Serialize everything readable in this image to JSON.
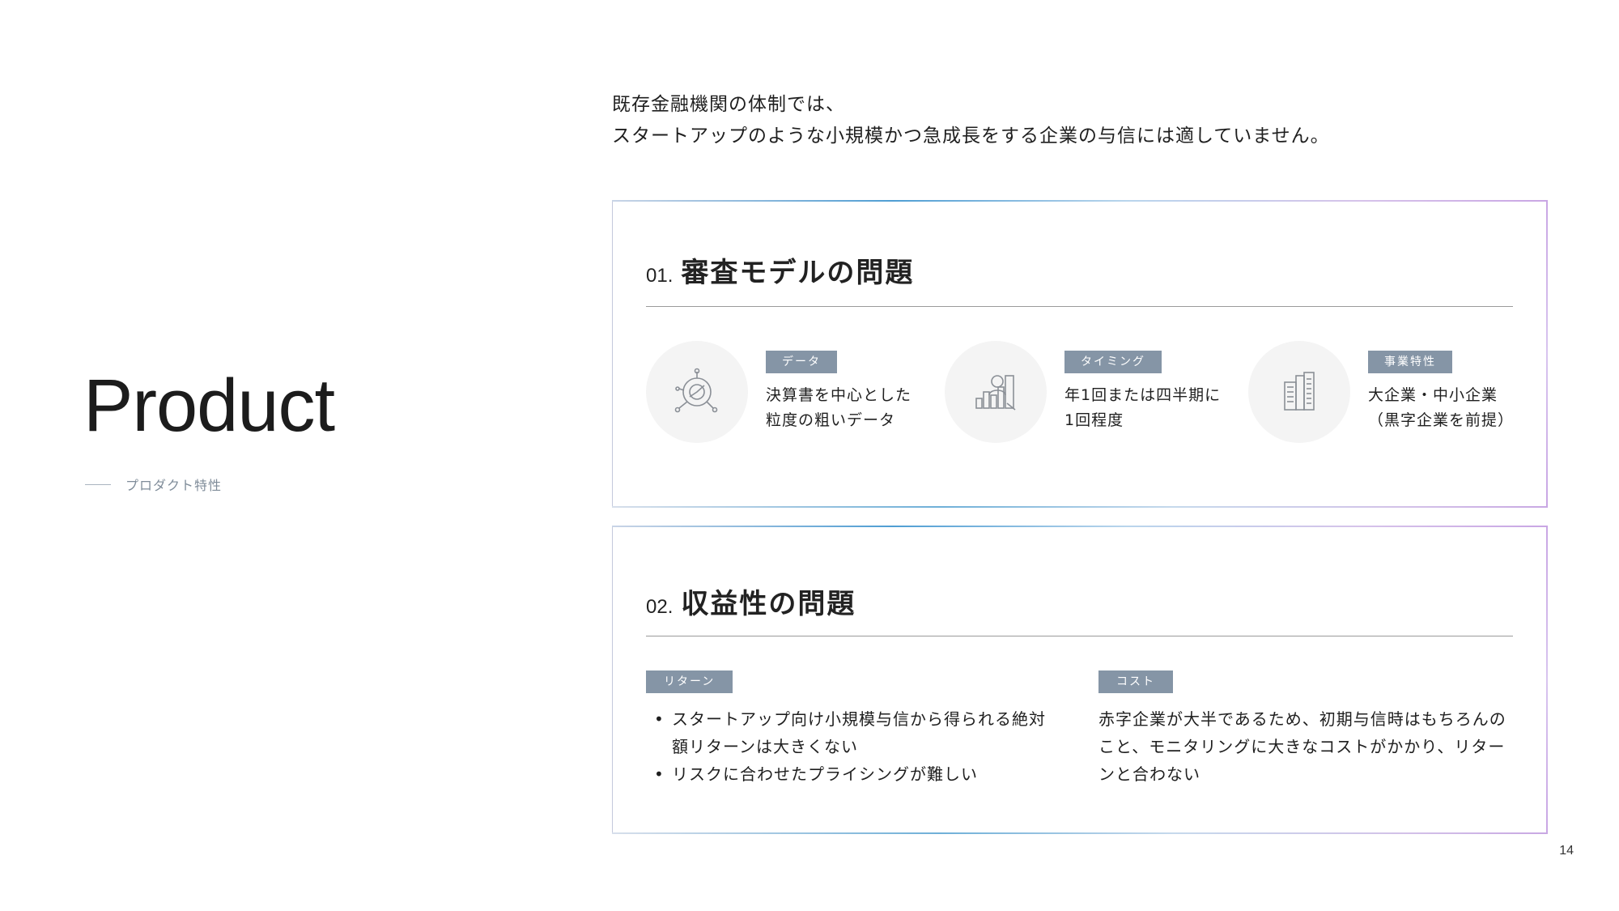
{
  "left": {
    "title": "Product",
    "subtitle": "プロダクト特性"
  },
  "intro": {
    "line1": "既存金融機関の体制では、",
    "line2": "スタートアップのような小規模かつ急成長をする企業の与信には適していません。"
  },
  "card1": {
    "number": "01.",
    "title": "審査モデルの問題",
    "features": [
      {
        "icon": "data-analysis-icon",
        "tag": "データ",
        "line1": "決算書を中心とした",
        "line2": "粒度の粗いデータ"
      },
      {
        "icon": "chart-person-icon",
        "tag": "タイミング",
        "line1": "年1回または四半期に",
        "line2": "1回程度"
      },
      {
        "icon": "building-icon",
        "tag": "事業特性",
        "line1": "大企業・中小企業",
        "line2": "（黒字企業を前提）"
      }
    ]
  },
  "card2": {
    "number": "02.",
    "title": "収益性の問題",
    "return": {
      "tag": "リターン",
      "bullets": [
        "スタートアップ向け小規模与信から得られる絶対額リターンは大きくない",
        "リスクに合わせたプライシングが難しい"
      ]
    },
    "cost": {
      "tag": "コスト",
      "text": "赤字企業が大半であるため、初期与信時はもちろんのこと、モニタリングに大きなコストがかかり、リターンと合わない"
    }
  },
  "page_number": "14"
}
